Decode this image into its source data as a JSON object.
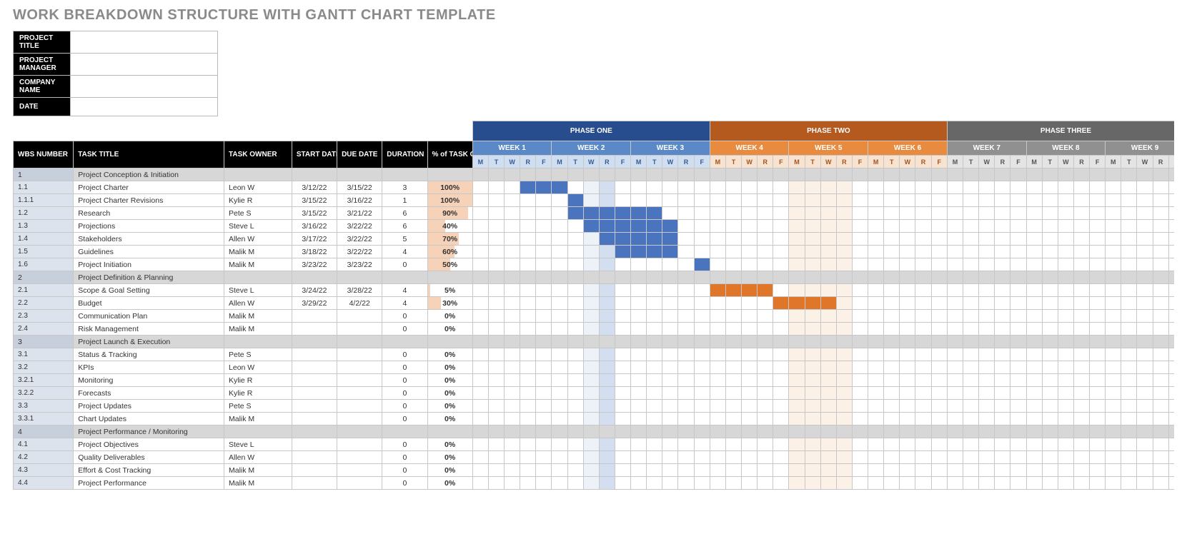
{
  "page_title": "WORK BREAKDOWN STRUCTURE WITH GANTT CHART TEMPLATE",
  "meta_labels": [
    "PROJECT TITLE",
    "PROJECT MANAGER",
    "COMPANY NAME",
    "DATE"
  ],
  "phases": [
    {
      "label": "PHASE ONE",
      "cls": "phase1",
      "wkcls": "wk1",
      "daycls": "day1",
      "weeks": [
        "WEEK 1",
        "WEEK 2",
        "WEEK 3"
      ]
    },
    {
      "label": "PHASE TWO",
      "cls": "phase2",
      "wkcls": "wk2",
      "daycls": "day2",
      "weeks": [
        "WEEK 4",
        "WEEK 5",
        "WEEK 6"
      ]
    },
    {
      "label": "PHASE THREE",
      "cls": "phase3",
      "wkcls": "wk3",
      "daycls": "day3",
      "weeks": [
        "WEEK 7",
        "WEEK 8",
        "WEEK 9"
      ]
    }
  ],
  "day_letters": [
    "M",
    "T",
    "W",
    "R",
    "F"
  ],
  "columns": {
    "wbs": "WBS NUMBER",
    "title": "TASK TITLE",
    "owner": "TASK OWNER",
    "start": "START DATE",
    "due": "DUE DATE",
    "dur": "DURATION",
    "pct": "% of TASK COMPLETE"
  },
  "chart_data": {
    "type": "gantt",
    "unit": "day",
    "days_per_week": 5,
    "total_days": 45,
    "tasks": [
      {
        "wbs": "1",
        "title": "Project Conception & Initiation",
        "section": true
      },
      {
        "wbs": "1.1",
        "title": "Project Charter",
        "owner": "Leon W",
        "start": "3/12/22",
        "due": "3/15/22",
        "dur": 3,
        "pct": 100,
        "bar_start": 3,
        "bar_len": 3,
        "phase": 1
      },
      {
        "wbs": "1.1.1",
        "title": "Project Charter Revisions",
        "owner": "Kylie R",
        "start": "3/15/22",
        "due": "3/16/22",
        "dur": 1,
        "pct": 100,
        "bar_start": 6,
        "bar_len": 1,
        "phase": 1
      },
      {
        "wbs": "1.2",
        "title": "Research",
        "owner": "Pete S",
        "start": "3/15/22",
        "due": "3/21/22",
        "dur": 6,
        "pct": 90,
        "bar_start": 6,
        "bar_len": 6,
        "phase": 1
      },
      {
        "wbs": "1.3",
        "title": "Projections",
        "owner": "Steve L",
        "start": "3/16/22",
        "due": "3/22/22",
        "dur": 6,
        "pct": 40,
        "bar_start": 7,
        "bar_len": 6,
        "phase": 1
      },
      {
        "wbs": "1.4",
        "title": "Stakeholders",
        "owner": "Allen W",
        "start": "3/17/22",
        "due": "3/22/22",
        "dur": 5,
        "pct": 70,
        "bar_start": 8,
        "bar_len": 5,
        "phase": 1
      },
      {
        "wbs": "1.5",
        "title": "Guidelines",
        "owner": "Malik M",
        "start": "3/18/22",
        "due": "3/22/22",
        "dur": 4,
        "pct": 60,
        "bar_start": 9,
        "bar_len": 4,
        "phase": 1
      },
      {
        "wbs": "1.6",
        "title": "Project Initiation",
        "owner": "Malik M",
        "start": "3/23/22",
        "due": "3/23/22",
        "dur": 0,
        "pct": 50,
        "bar_start": 14,
        "bar_len": 1,
        "phase": 1
      },
      {
        "wbs": "2",
        "title": "Project Definition & Planning",
        "section": true
      },
      {
        "wbs": "2.1",
        "title": "Scope & Goal Setting",
        "owner": "Steve L",
        "start": "3/24/22",
        "due": "3/28/22",
        "dur": 4,
        "pct": 5,
        "bar_start": 15,
        "bar_len": 4,
        "phase": 2
      },
      {
        "wbs": "2.2",
        "title": "Budget",
        "owner": "Allen W",
        "start": "3/29/22",
        "due": "4/2/22",
        "dur": 4,
        "pct": 30,
        "bar_start": 19,
        "bar_len": 4,
        "phase": 2
      },
      {
        "wbs": "2.3",
        "title": "Communication Plan",
        "owner": "Malik M",
        "dur": 0,
        "pct": 0
      },
      {
        "wbs": "2.4",
        "title": "Risk Management",
        "owner": "Malik M",
        "dur": 0,
        "pct": 0
      },
      {
        "wbs": "3",
        "title": "Project Launch & Execution",
        "section": true
      },
      {
        "wbs": "3.1",
        "title": "Status & Tracking",
        "owner": "Pete S",
        "dur": 0,
        "pct": 0
      },
      {
        "wbs": "3.2",
        "title": "KPIs",
        "owner": "Leon W",
        "dur": 0,
        "pct": 0
      },
      {
        "wbs": "3.2.1",
        "title": "Monitoring",
        "owner": "Kylie R",
        "dur": 0,
        "pct": 0
      },
      {
        "wbs": "3.2.2",
        "title": "Forecasts",
        "owner": "Kylie R",
        "dur": 0,
        "pct": 0
      },
      {
        "wbs": "3.3",
        "title": "Project Updates",
        "owner": "Pete S",
        "dur": 0,
        "pct": 0
      },
      {
        "wbs": "3.3.1",
        "title": "Chart Updates",
        "owner": "Malik M",
        "dur": 0,
        "pct": 0
      },
      {
        "wbs": "4",
        "title": "Project Performance / Monitoring",
        "section": true
      },
      {
        "wbs": "4.1",
        "title": "Project Objectives",
        "owner": "Steve L",
        "dur": 0,
        "pct": 0
      },
      {
        "wbs": "4.2",
        "title": "Quality Deliverables",
        "owner": "Allen W",
        "dur": 0,
        "pct": 0
      },
      {
        "wbs": "4.3",
        "title": "Effort & Cost Tracking",
        "owner": "Malik M",
        "dur": 0,
        "pct": 0
      },
      {
        "wbs": "4.4",
        "title": "Project Performance",
        "owner": "Malik M",
        "dur": 0,
        "pct": 0
      }
    ],
    "highlight_columns_light": [
      7,
      20,
      21,
      22,
      23
    ],
    "highlight_columns_dark": [
      8
    ]
  }
}
